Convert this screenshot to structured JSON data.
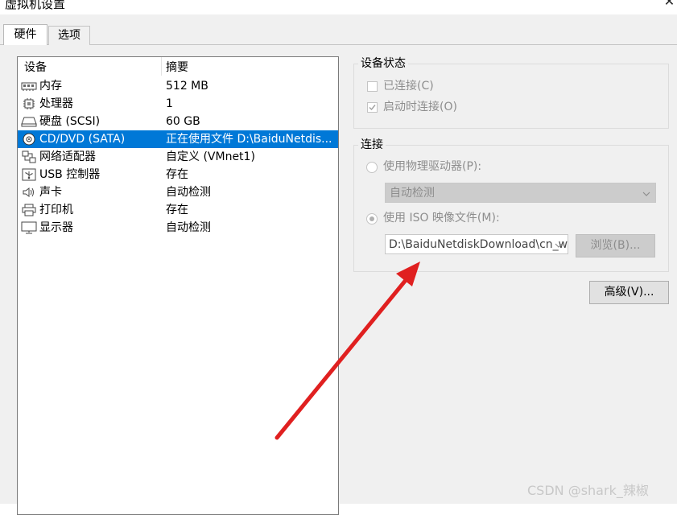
{
  "window": {
    "title": "虚拟机设置",
    "close_glyph": "✕"
  },
  "tabs": [
    {
      "label": "硬件"
    },
    {
      "label": "选项"
    }
  ],
  "device_list": {
    "columns": {
      "device": "设备",
      "summary": "摘要"
    },
    "rows": [
      {
        "icon": "memory-icon",
        "name": "内存",
        "summary": "512 MB"
      },
      {
        "icon": "processor-icon",
        "name": "处理器",
        "summary": "1"
      },
      {
        "icon": "hard-disk-icon",
        "name": "硬盘 (SCSI)",
        "summary": "60 GB"
      },
      {
        "icon": "cd-dvd-icon",
        "name": "CD/DVD (SATA)",
        "summary": "正在使用文件 D:\\BaiduNetdis...",
        "selected": true
      },
      {
        "icon": "network-adapter-icon",
        "name": "网络适配器",
        "summary": "自定义 (VMnet1)"
      },
      {
        "icon": "usb-controller-icon",
        "name": "USB 控制器",
        "summary": "存在"
      },
      {
        "icon": "sound-card-icon",
        "name": "声卡",
        "summary": "自动检测"
      },
      {
        "icon": "printer-icon",
        "name": "打印机",
        "summary": "存在"
      },
      {
        "icon": "display-icon",
        "name": "显示器",
        "summary": "自动检测"
      }
    ]
  },
  "device_status": {
    "title": "设备状态",
    "connected": {
      "label": "已连接(C)",
      "checked": false
    },
    "connect_at_power_on": {
      "label": "启动时连接(O)",
      "checked": true
    }
  },
  "connection": {
    "title": "连接",
    "physical_drive": {
      "label": "使用物理驱动器(P):",
      "selected": false,
      "value": "自动检测"
    },
    "iso_image": {
      "label": "使用 ISO 映像文件(M):",
      "selected": true,
      "value": "D:\\BaiduNetdiskDownload\\cn_w"
    },
    "browse_label": "浏览(B)..."
  },
  "advanced_label": "高级(V)...",
  "watermark": "CSDN @shark_辣椒",
  "colors": {
    "selection": "#0078d7",
    "annotation_arrow": "#e02020"
  }
}
